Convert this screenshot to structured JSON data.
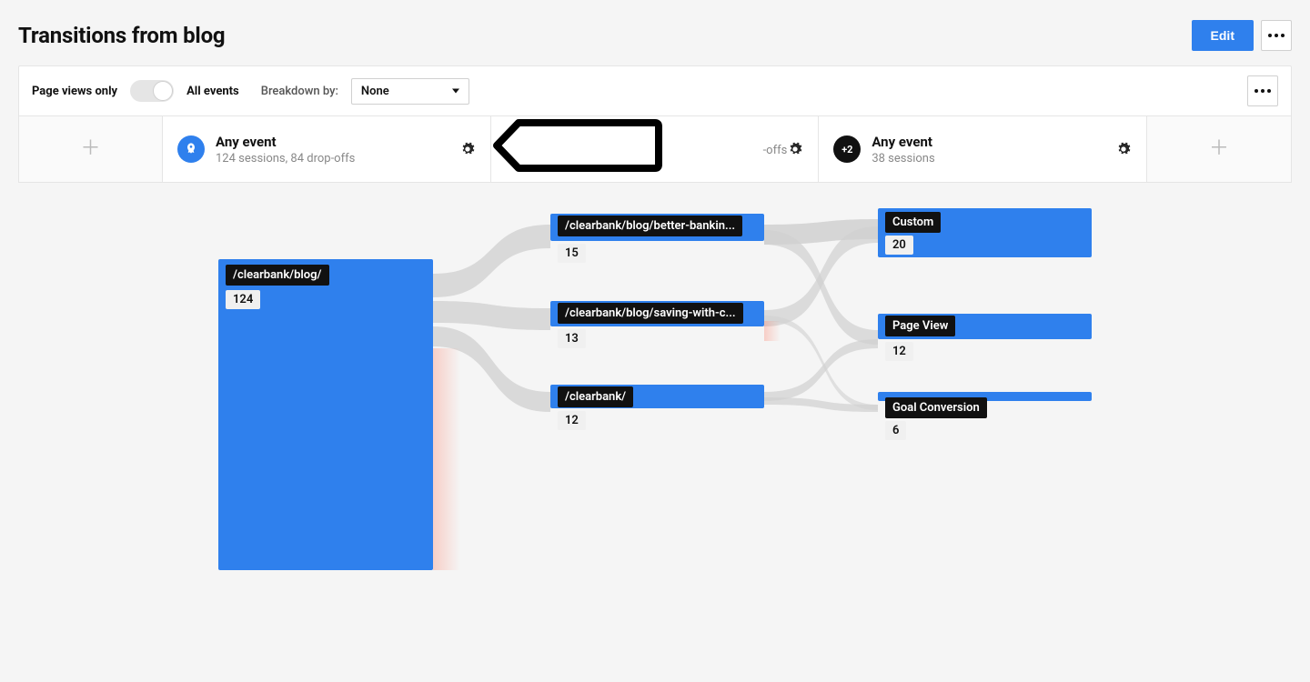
{
  "header": {
    "title": "Transitions from blog",
    "edit_label": "Edit"
  },
  "toolbar": {
    "page_views_only_label": "Page views only",
    "all_events_label": "All events",
    "breakdown_label": "Breakdown by:",
    "breakdown_value": "None"
  },
  "steps": [
    {
      "type": "add"
    },
    {
      "type": "event",
      "icon": "rocket",
      "title": "Any event",
      "subtitle": "124 sessions, 84 drop-offs"
    },
    {
      "type": "event",
      "icon": "hidden",
      "title": "",
      "subtitle": "-offs"
    },
    {
      "type": "event",
      "icon": "badge",
      "badge": "+2",
      "title": "Any event",
      "subtitle": "38 sessions"
    },
    {
      "type": "add"
    }
  ],
  "sankey": {
    "col1": [
      {
        "label": "/clearbank/blog/",
        "count": "124"
      }
    ],
    "col2": [
      {
        "label": "/clearbank/blog/better-bankin...",
        "count": "15"
      },
      {
        "label": "/clearbank/blog/saving-with-c...",
        "count": "13"
      },
      {
        "label": "/clearbank/",
        "count": "12"
      }
    ],
    "col3": [
      {
        "label": "Custom",
        "count": "20"
      },
      {
        "label": "Page View",
        "count": "12"
      },
      {
        "label": "Goal Conversion",
        "count": "6"
      }
    ]
  }
}
